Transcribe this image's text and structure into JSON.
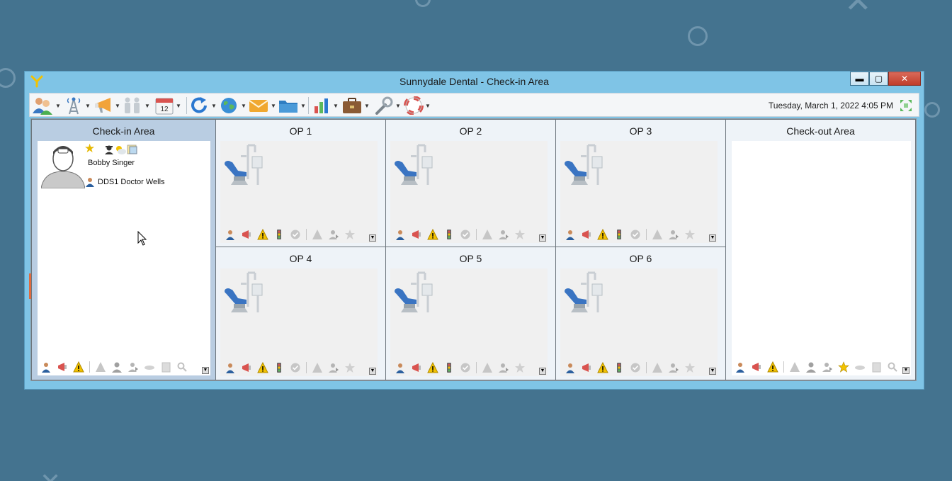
{
  "window": {
    "title": "Sunnydale Dental - Check-in Area",
    "controls": {
      "minimize": "▬",
      "maximize": "▢",
      "close": "✕"
    }
  },
  "toolbar": {
    "items": [
      {
        "icon": "patients-icon"
      },
      {
        "icon": "radio-tower-icon"
      },
      {
        "icon": "megaphone-icon"
      },
      {
        "icon": "family-icon"
      },
      {
        "icon": "calendar-icon",
        "badge": "12"
      },
      {
        "icon": "refresh-icon"
      },
      {
        "icon": "globe-icon"
      },
      {
        "icon": "mail-icon"
      },
      {
        "icon": "folder-icon"
      },
      {
        "icon": "chart-icon"
      },
      {
        "icon": "briefcase-icon"
      },
      {
        "icon": "tools-icon"
      },
      {
        "icon": "help-lifebuoy-icon"
      }
    ],
    "datetime": "Tuesday, March 1, 2022 4:05 PM"
  },
  "areas": {
    "checkin": {
      "title": "Check-in Area",
      "patient": {
        "name": "Bobby Singer",
        "provider": "DDS1 Doctor Wells"
      }
    },
    "ops": [
      {
        "title": "OP 1"
      },
      {
        "title": "OP 2"
      },
      {
        "title": "OP 3"
      },
      {
        "title": "OP 4"
      },
      {
        "title": "OP 5"
      },
      {
        "title": "OP 6"
      }
    ],
    "checkout": {
      "title": "Check-out Area"
    }
  },
  "colors": {
    "desktop": "#44738f",
    "window_frame": "#7fc4e6",
    "close_button": "#c13d2b",
    "warning": "#f2c200"
  }
}
